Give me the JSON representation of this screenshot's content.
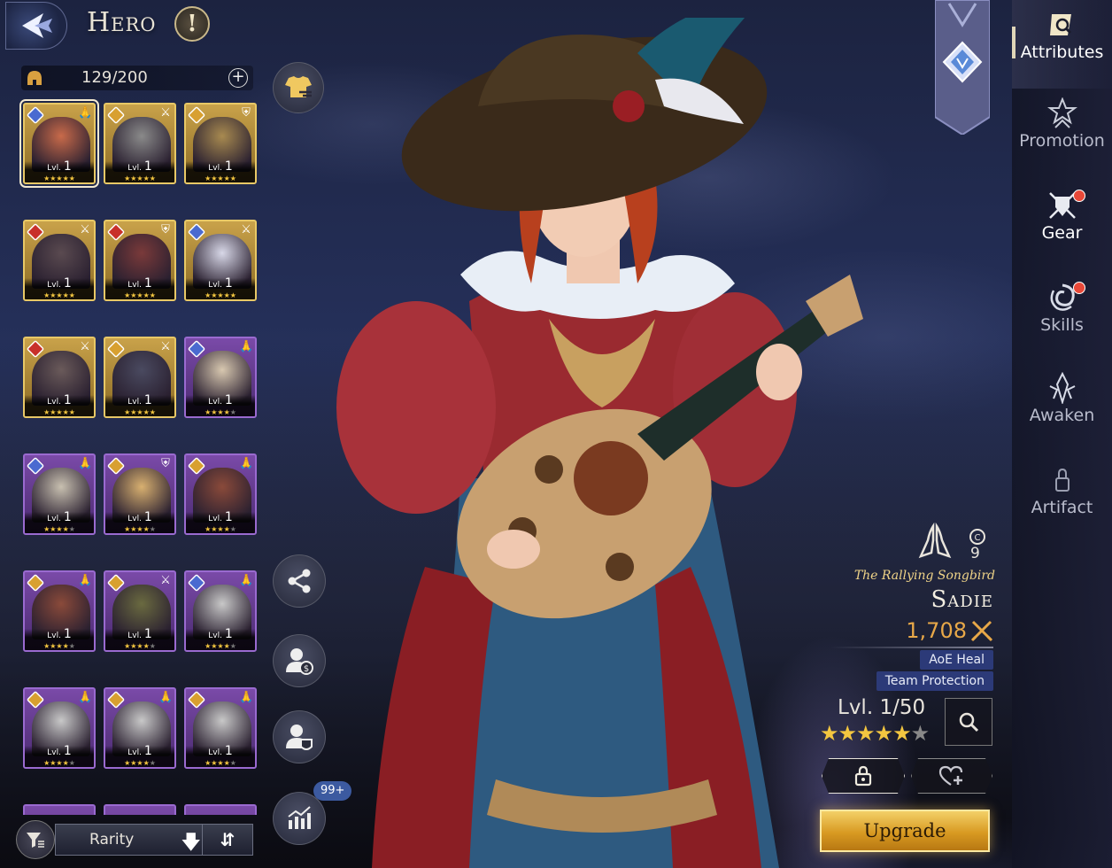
{
  "header": {
    "title": "Hero",
    "info_label": "!"
  },
  "roster": {
    "capacity": "129/200",
    "add_label": "+",
    "cards": [
      {
        "name": "hero-card-sadie",
        "rarity": "gold",
        "affinity": "blue",
        "role": "support",
        "level_label": "Lvl.",
        "level": "1",
        "stars": 5,
        "selected": true
      },
      {
        "name": "hero-card-dwarf",
        "rarity": "gold",
        "affinity": "gold",
        "role": "attack",
        "level_label": "Lvl.",
        "level": "1",
        "stars": 5
      },
      {
        "name": "hero-card-elf-warrior",
        "rarity": "gold",
        "affinity": "gold",
        "role": "defense",
        "level_label": "Lvl.",
        "level": "1",
        "stars": 5
      },
      {
        "name": "hero-card-dark-knight",
        "rarity": "gold",
        "affinity": "red",
        "role": "attack",
        "level_label": "Lvl.",
        "level": "1",
        "stars": 5
      },
      {
        "name": "hero-card-beast",
        "rarity": "gold",
        "affinity": "red",
        "role": "defense",
        "level_label": "Lvl.",
        "level": "1",
        "stars": 5
      },
      {
        "name": "hero-card-fox",
        "rarity": "gold",
        "affinity": "blue",
        "role": "attack",
        "level_label": "Lvl.",
        "level": "1",
        "stars": 5
      },
      {
        "name": "hero-card-vampire",
        "rarity": "gold",
        "affinity": "red",
        "role": "attack",
        "level_label": "Lvl.",
        "level": "1",
        "stars": 5
      },
      {
        "name": "hero-card-pharaoh",
        "rarity": "gold",
        "affinity": "gold",
        "role": "attack",
        "level_label": "Lvl.",
        "level": "1",
        "stars": 5
      },
      {
        "name": "hero-card-priestess",
        "rarity": "purple",
        "affinity": "blue",
        "role": "support",
        "level_label": "Lvl.",
        "level": "1",
        "stars": 4
      },
      {
        "name": "hero-card-priestess-2",
        "rarity": "purple",
        "affinity": "blue",
        "role": "support",
        "level_label": "Lvl.",
        "level": "1",
        "stars": 4
      },
      {
        "name": "hero-card-blonde",
        "rarity": "purple",
        "affinity": "gold",
        "role": "defense",
        "level_label": "Lvl.",
        "level": "1",
        "stars": 4
      },
      {
        "name": "hero-card-redhead",
        "rarity": "purple",
        "affinity": "gold",
        "role": "support",
        "level_label": "Lvl.",
        "level": "1",
        "stars": 4
      },
      {
        "name": "hero-card-redhead-2",
        "rarity": "purple",
        "affinity": "gold",
        "role": "support",
        "level_label": "Lvl.",
        "level": "1",
        "stars": 4
      },
      {
        "name": "hero-card-ranger",
        "rarity": "purple",
        "affinity": "gold",
        "role": "attack",
        "level_label": "Lvl.",
        "level": "1",
        "stars": 4
      },
      {
        "name": "hero-card-elder",
        "rarity": "purple",
        "affinity": "blue",
        "role": "support",
        "level_label": "Lvl.",
        "level": "1",
        "stars": 4
      },
      {
        "name": "hero-card-elder-2",
        "rarity": "purple",
        "affinity": "gold",
        "role": "support",
        "level_label": "Lvl.",
        "level": "1",
        "stars": 4
      },
      {
        "name": "hero-card-elder-3",
        "rarity": "purple",
        "affinity": "gold",
        "role": "support",
        "level_label": "Lvl.",
        "level": "1",
        "stars": 4
      },
      {
        "name": "hero-card-elder-4",
        "rarity": "purple",
        "affinity": "gold",
        "role": "support",
        "level_label": "Lvl.",
        "level": "1",
        "stars": 4
      }
    ]
  },
  "filter": {
    "sort_label": "Rarity",
    "sort_arrow": "🡇",
    "toggle_label": "⇵"
  },
  "actions": {
    "stats_badge": "99+"
  },
  "nav": {
    "items": [
      {
        "label": "Attributes",
        "active": true,
        "dot": false
      },
      {
        "label": "Promotion",
        "active": false,
        "dot": false
      },
      {
        "label": "Gear",
        "active": false,
        "dot": true
      },
      {
        "label": "Skills",
        "active": false,
        "dot": true
      },
      {
        "label": "Awaken",
        "active": false,
        "dot": false
      },
      {
        "label": "Artifact",
        "active": false,
        "dot": false
      }
    ]
  },
  "hero": {
    "ascension_count": "9",
    "epithet": "The Rallying Songbird",
    "name": "Sadie",
    "power": "1,708",
    "tags": [
      "AoE Heal",
      "Team Protection"
    ],
    "level": "Lvl. 1/50",
    "stars_filled": 5,
    "stars_total": 6,
    "upgrade_label": "Upgrade"
  },
  "colors": {
    "gold_card": "#c9a24a",
    "purple_card": "#7a4aa8",
    "power": "#e8a848",
    "upgrade": "#f3d068",
    "tag": "#2c3a78",
    "notification": "#e84838"
  }
}
